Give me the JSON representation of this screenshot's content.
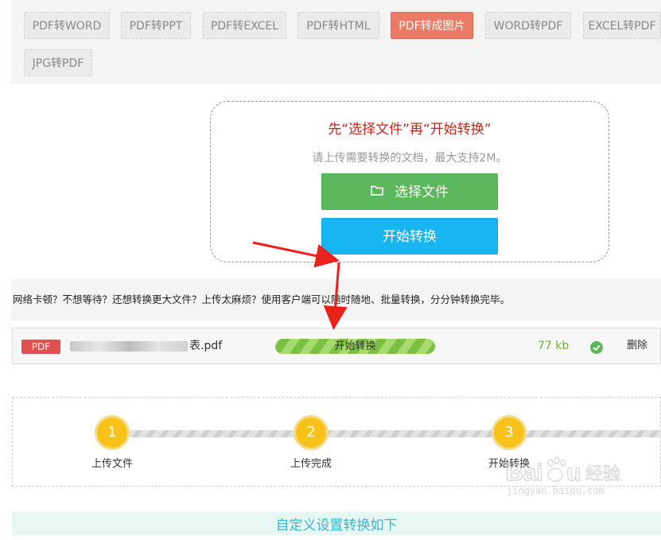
{
  "tabs": [
    {
      "label": "PDF转WORD",
      "active": false
    },
    {
      "label": "PDF转PPT",
      "active": false
    },
    {
      "label": "PDF转EXCEL",
      "active": false
    },
    {
      "label": "PDF转HTML",
      "active": false
    },
    {
      "label": "PDF转成图片",
      "active": true
    },
    {
      "label": "WORD转PDF",
      "active": false
    },
    {
      "label": "EXCEL转PDF",
      "active": false
    },
    {
      "label": "JPG转PDF",
      "active": false
    }
  ],
  "upload": {
    "title": "先“选择文件”再“开始转换”",
    "hint": "请上传需要转换的文档，最大支持2M。",
    "select_label": "选择文件",
    "start_label": "开始转换"
  },
  "notice": "网络卡顿？不想等待？还想转换更大文件？上传太麻烦？使用客户端可以随时随地、批量转换，分分钟转换完毕。",
  "file": {
    "type_badge": "PDF",
    "name_suffix": "表.pdf",
    "progress_label": "开始转换",
    "size": "77 kb",
    "delete_label": "删除"
  },
  "steps": [
    {
      "number": "1",
      "label": "上传文件"
    },
    {
      "number": "2",
      "label": "上传完成"
    },
    {
      "number": "3",
      "label": "开始转换"
    }
  ],
  "custom_settings": "自定义设置转换如下",
  "watermark": {
    "text": "jingyan.baidu.com"
  },
  "colors": {
    "active_tab": "#eb7a66",
    "select_button": "#5cb85c",
    "start_button": "#17b6f0",
    "title_red": "#c0281c",
    "step_yellow": "#f8c21a",
    "progress_green": "#7bc043",
    "annotation_arrow": "#e8231c"
  }
}
